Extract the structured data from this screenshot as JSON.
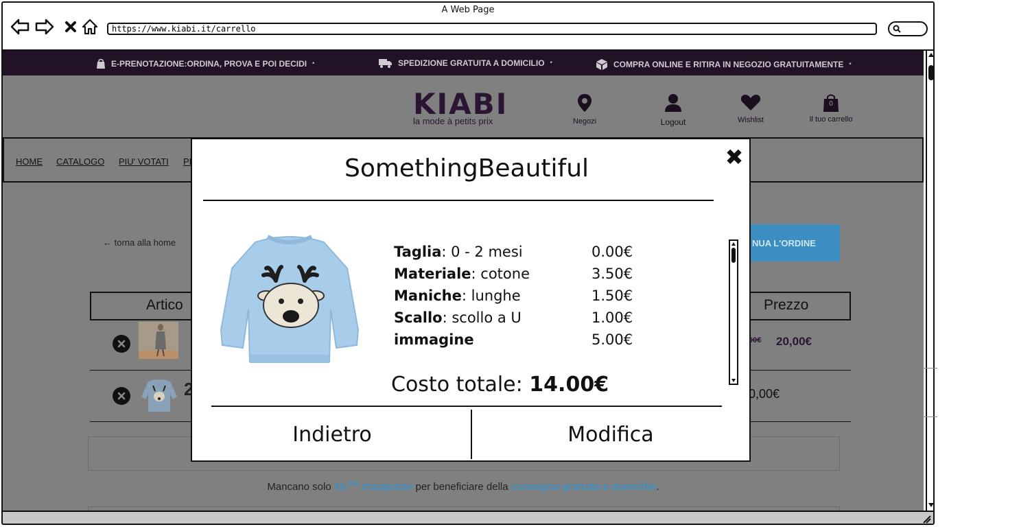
{
  "window": {
    "title": "A Web Page",
    "url": "https://www.kiabi.it/carrello"
  },
  "promo": [
    {
      "icon": "bag-icon",
      "label": "E-PRENOTAZIONE:ORDINA, PROVA E POI DECIDI",
      "sup": "*"
    },
    {
      "icon": "truck-icon",
      "label": "SPEDIZIONE GRATUITA A DOMICILIO",
      "sup": "*"
    },
    {
      "icon": "box-icon",
      "label": "COMPRA ONLINE E RITIRA IN NEGOZIO GRATUITAMENTE",
      "sup": "*"
    }
  ],
  "logo": {
    "name": "KIABI",
    "tagline": "la mode à petits prix"
  },
  "header": {
    "stores": "Negozi",
    "logout": "Logout",
    "wishlist": "Wishlist",
    "cart": "Il tuo carrello",
    "cart_count": "0"
  },
  "menu": [
    "HOME",
    "CATALOGO",
    "PIU' VOTATI",
    "PI"
  ],
  "cart": {
    "back_link": "← torna alla home",
    "continue_label": "NUA L'ORDINE",
    "col_article": "Artico",
    "col_price": "Prezzo",
    "rows": [
      {
        "old_price": "00€",
        "price": "20,00€"
      },
      {
        "price": "0,00€"
      }
    ]
  },
  "free_shipping": {
    "prefix": "Mancano solo ",
    "amount": "10,",
    "amount_cents": "00€",
    "amount_suffix": " d'acquisto",
    "middle": " per beneficiare della ",
    "link": "consegna gratuita a domicilio",
    "end": "."
  },
  "modal": {
    "title": "SomethingBeautiful",
    "options": [
      {
        "name": "Taglia",
        "value": ": 0 - 2 mesi",
        "price": "0.00€"
      },
      {
        "name": "Materiale",
        "value": ": cotone",
        "price": "3.50€"
      },
      {
        "name": "Maniche",
        "value": ": lunghe",
        "price": "1.50€"
      },
      {
        "name": "Scallo",
        "value": ": scollo a U",
        "price": "1.00€"
      },
      {
        "name": "immagine",
        "value": "",
        "price": "5.00€"
      }
    ],
    "total_label": "Costo totale: ",
    "total_value": "14.00€",
    "back_label": "Indietro",
    "edit_label": "Modifica"
  },
  "colors": {
    "promo_bg": "#211226",
    "accent_blue": "#3c8ec1",
    "brand": "#2a1533",
    "overlay": "#808080"
  }
}
